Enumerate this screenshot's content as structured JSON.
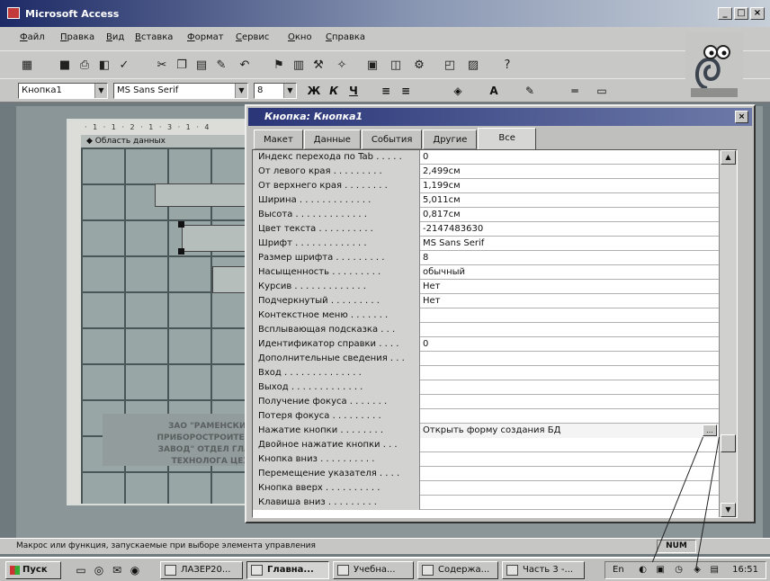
{
  "window": {
    "title": "Microsoft Access",
    "buttons": [
      "_",
      "□",
      "×"
    ]
  },
  "menu": [
    "Файл",
    "Правка",
    "Вид",
    "Вставка",
    "Формат",
    "Сервис",
    "Окно",
    "Справка"
  ],
  "toolbar_icons": [
    "view-icon",
    "save-icon",
    "print-icon",
    "preview-icon",
    "spelling-icon",
    "cut-icon",
    "copy-icon",
    "paste-icon",
    "format-painter-icon",
    "undo-icon",
    "insert-hyperlink-icon",
    "field-list-icon",
    "toolbox-icon",
    "autoformat-icon",
    "code-icon",
    "properties-icon",
    "build-icon",
    "database-window-icon",
    "new-object-icon",
    "help-icon"
  ],
  "format_bar": {
    "object": "Кнопка1",
    "font": "MS Sans Serif",
    "size": "8",
    "bold": "Ж",
    "italic": "К",
    "underline": "Ч"
  },
  "design": {
    "section_header": "Область данных",
    "ruler": "· 1 · 1 · 2 · 1 · 3 · 1 · 4",
    "title_control": "Си",
    "button1": "Созд",
    "button2": "О",
    "label_lines": [
      "ЗАО \"РАМЕНСКИЙ",
      "ПРИБОРОСТРОИТЕЛЬН",
      "ЗАВОД\" ОТДЕЛ ГЛАВН",
      "ТЕХНОЛОГА ЦЕХ"
    ]
  },
  "props": {
    "title": "Кнопка: Кнопка1",
    "close": "×",
    "tabs": [
      "Макет",
      "Данные",
      "События",
      "Другие",
      "Все"
    ],
    "active_tab": "Все",
    "rows": [
      {
        "name": "Индекс перехода по Tab . . . . .",
        "value": "0"
      },
      {
        "name": "От левого края . . . . . . . . .",
        "value": "2,499см"
      },
      {
        "name": "От верхнего края . . . . . . . .",
        "value": "1,199см"
      },
      {
        "name": "Ширина . . . . . . . . . . . . .",
        "value": "5,011см"
      },
      {
        "name": "Высота . . . . . . . . . . . . .",
        "value": "0,817см"
      },
      {
        "name": "Цвет текста . . . . . . . . . .",
        "value": "-2147483630"
      },
      {
        "name": "Шрифт . . . . . . . . . . . . .",
        "value": "MS Sans Serif"
      },
      {
        "name": "Размер шрифта . . . . . . . . .",
        "value": "8"
      },
      {
        "name": "Насыщенность . . . . . . . . .",
        "value": "обычный"
      },
      {
        "name": "Курсив . . . . . . . . . . . . .",
        "value": "Нет"
      },
      {
        "name": "Подчеркнутый . . . . . . . . .",
        "value": "Нет"
      },
      {
        "name": "Контекстное меню . . . . . . .",
        "value": ""
      },
      {
        "name": "Всплывающая подсказка . . .",
        "value": ""
      },
      {
        "name": "Идентификатор справки . . . .",
        "value": "0"
      },
      {
        "name": "Дополнительные сведения . . .",
        "value": ""
      },
      {
        "name": "Вход . . . . . . . . . . . . . .",
        "value": ""
      },
      {
        "name": "Выход . . . . . . . . . . . . .",
        "value": ""
      },
      {
        "name": "Получение фокуса . . . . . . .",
        "value": ""
      },
      {
        "name": "Потеря фокуса . . . . . . . . .",
        "value": ""
      },
      {
        "name": "Нажатие кнопки . . . . . . . .",
        "value": "Открыть форму создания БД"
      },
      {
        "name": "Двойное нажатие кнопки . . .",
        "value": ""
      },
      {
        "name": "Кнопка вниз . . . . . . . . . .",
        "value": ""
      },
      {
        "name": "Перемещение указателя . . . .",
        "value": ""
      },
      {
        "name": "Кнопка вверх . . . . . . . . . .",
        "value": ""
      },
      {
        "name": "Клавиша вниз . . . . . . . . .",
        "value": ""
      }
    ],
    "builder_button": "…"
  },
  "status": {
    "text": "Макрос или функция, запускаемые при выборе элемента управления",
    "num": "NUM"
  },
  "taskbar": {
    "start": "Пуск",
    "tasks": [
      "ЛАЗЕР20...",
      "Главна...",
      "Учебна...",
      "Содержа...",
      "Часть 3 -..."
    ],
    "active_task": "Главна...",
    "clock": "16:51"
  }
}
